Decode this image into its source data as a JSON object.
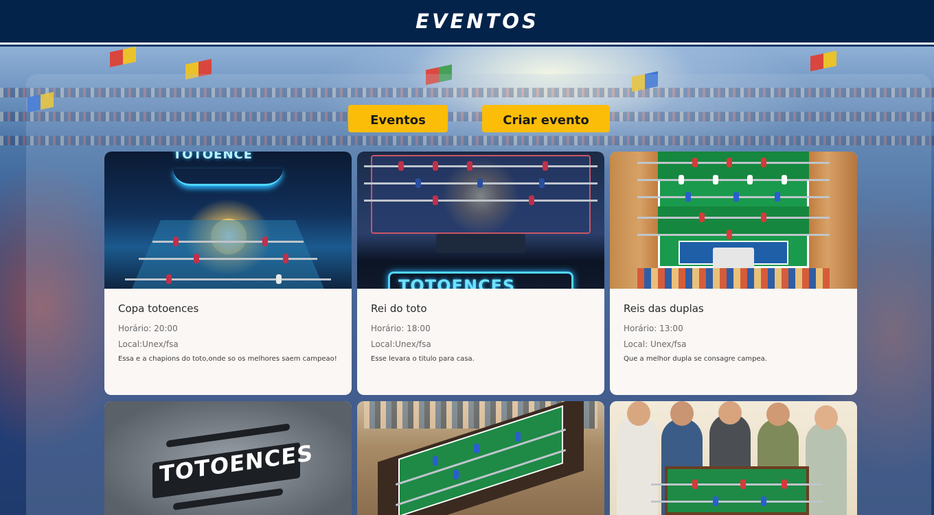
{
  "header": {
    "title": "EVENTOS"
  },
  "nav": {
    "eventos_label": "Eventos",
    "criar_label": "Criar evento"
  },
  "cards": [
    {
      "title": "Copa totoences",
      "horario": "Horário: 20:00",
      "local": "Local:Unex/fsa",
      "description": "Essa e a chapions do toto,onde so os melhores saem campeao!"
    },
    {
      "title": "Rei do toto",
      "horario": "Horário: 18:00",
      "local": "Local:Unex/fsa",
      "description": "Esse levara o titulo para casa."
    },
    {
      "title": "Reis das duplas",
      "horario": "Horário: 13:00",
      "local": "Local: Unex/fsa",
      "description": "Que a melhor dupla se consagre campea."
    }
  ],
  "image_logos": {
    "card1": "TOTOENCE",
    "card2": "TOTOENCES",
    "card4": "TOTOENCES"
  },
  "colors": {
    "header_bg": "#04234a",
    "accent": "#fbbd08",
    "card_bg": "#faf7f5"
  }
}
